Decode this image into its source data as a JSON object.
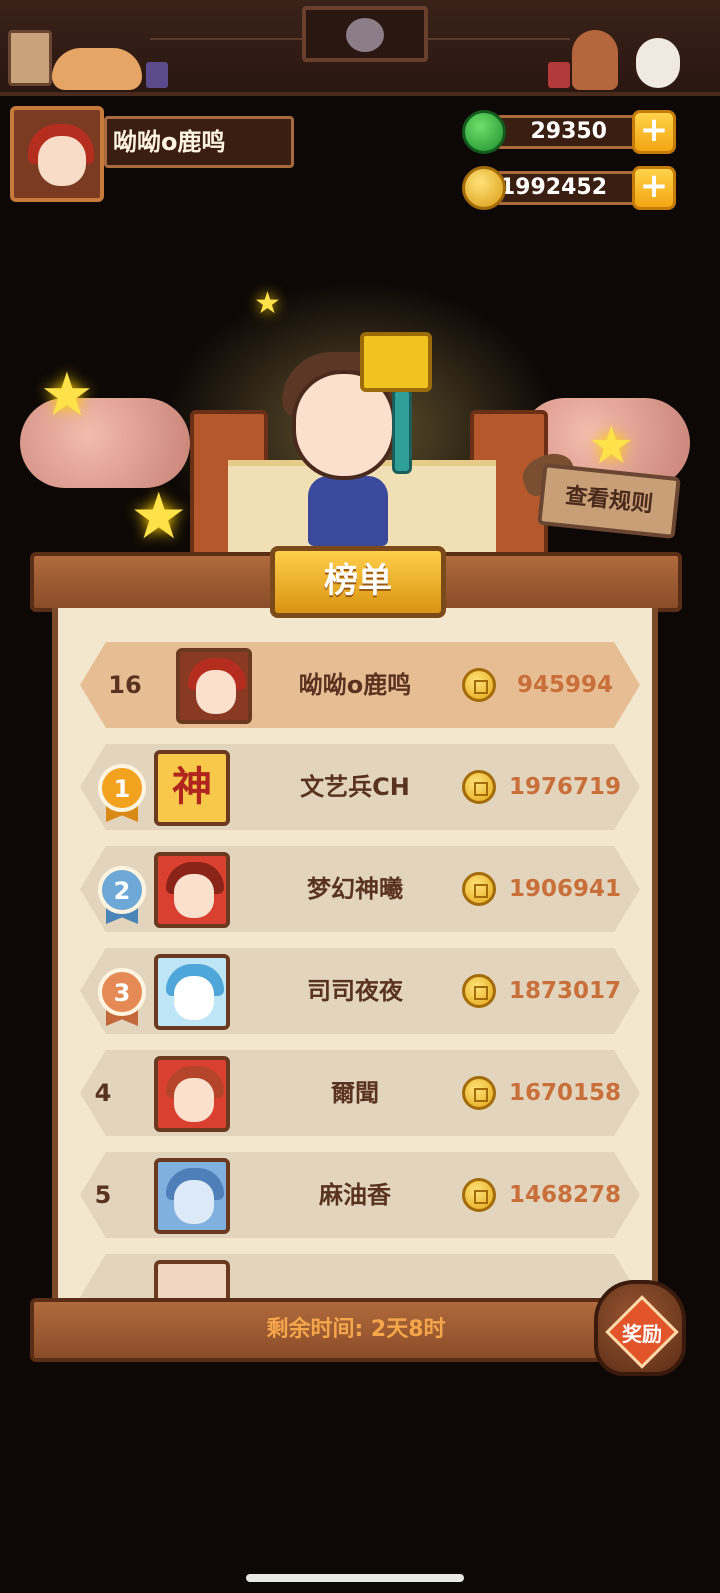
{
  "player": {
    "name": "呦呦o鹿鸣",
    "jade": "29350",
    "coins": "1992452"
  },
  "stage": {
    "rules_button": "查看规则"
  },
  "leaderboard": {
    "title": "榜单",
    "self_row": {
      "rank": "16",
      "name": "呦呦o鹿鸣",
      "score": "945994"
    },
    "rows": [
      {
        "rank": "1",
        "name": "文艺兵CH",
        "score": "1976719",
        "avatar": "神"
      },
      {
        "rank": "2",
        "name": "梦幻神曦",
        "score": "1906941"
      },
      {
        "rank": "3",
        "name": "司司夜夜",
        "score": "1873017"
      },
      {
        "rank": "4",
        "name": "爾聞",
        "score": "1670158"
      },
      {
        "rank": "5",
        "name": "麻油香",
        "score": "1468278"
      }
    ],
    "remaining_time": "剩余时间: 2天8时"
  },
  "reward": {
    "label": "奖励"
  },
  "colors": {
    "accent": "#f2c21e",
    "score": "#c9703a",
    "gold_medal": "#f2a21e",
    "silver_medal": "#6ea8d6",
    "bronze_medal": "#e58a55"
  },
  "icons": [
    "jade-icon",
    "coin-icon",
    "plus-icon",
    "medal-icon",
    "star-icon"
  ]
}
